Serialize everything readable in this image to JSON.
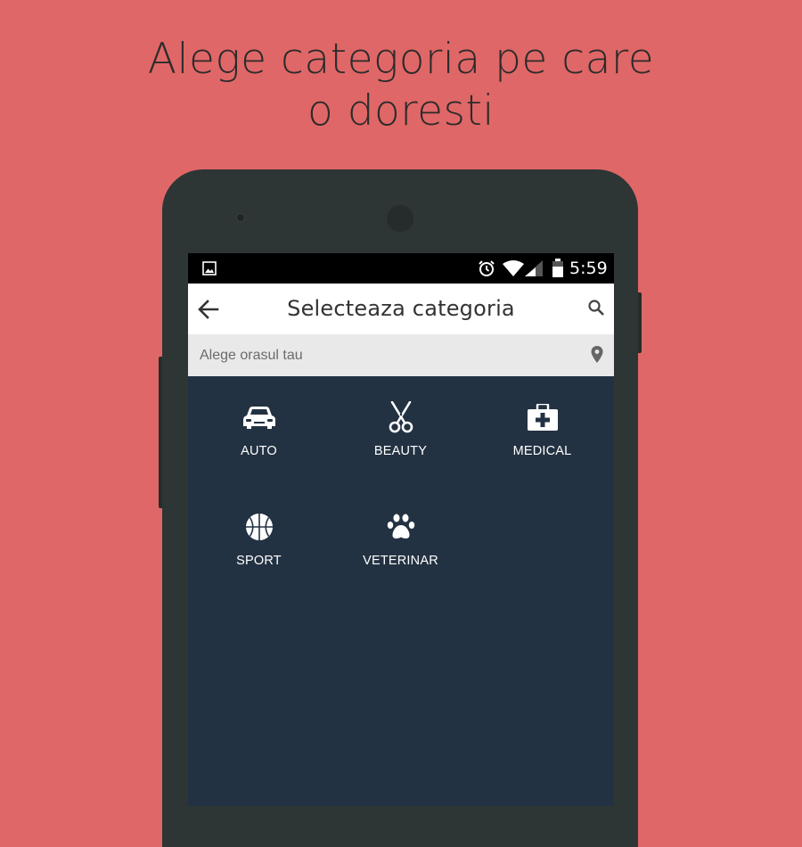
{
  "headline": {
    "line1": "Alege categoria pe care",
    "line2": "o doresti"
  },
  "status_bar": {
    "time": "5:59",
    "icons": [
      "gallery-icon",
      "alarm-icon",
      "wifi-icon",
      "signal-icon",
      "battery-icon"
    ]
  },
  "app_bar": {
    "title": "Selecteaza categoria",
    "back_icon": "arrow-back-icon",
    "search_icon": "search-icon"
  },
  "city": {
    "placeholder": "Alege orasul tau",
    "icon": "location-pin-icon"
  },
  "categories": [
    {
      "label": "AUTO",
      "icon": "car-icon"
    },
    {
      "label": "BEAUTY",
      "icon": "scissors-icon"
    },
    {
      "label": "MEDICAL",
      "icon": "medical-kit-icon"
    },
    {
      "label": "SPORT",
      "icon": "basketball-icon"
    },
    {
      "label": "VETERINAR",
      "icon": "paw-icon"
    }
  ],
  "colors": {
    "background": "#e06767",
    "phone_body": "#2e3535",
    "screen": "#233242",
    "app_bar": "#ffffff",
    "city_bar": "#e9e9e9"
  }
}
